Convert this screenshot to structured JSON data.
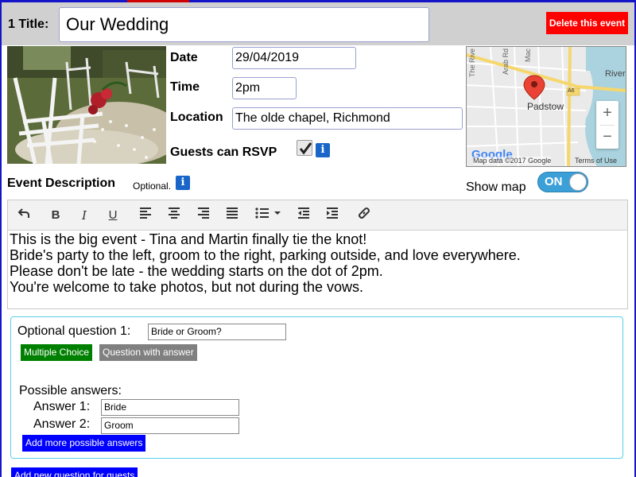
{
  "header": {
    "title_label": "1 Title:",
    "title_value": "Our Wedding",
    "delete_label": "Delete this event"
  },
  "details": {
    "date_label": "Date",
    "date_value": "29/04/2019",
    "time_label": "Time",
    "time_value": "2pm",
    "location_label": "Location",
    "location_value": "The olde chapel, Richmond",
    "rsvp_label": "Guests can RSVP",
    "rsvp_checked": true
  },
  "map": {
    "place_label": "Padstow",
    "river_label": "River",
    "road_a6": "A6",
    "street_1": "The Rive",
    "street_2": "Arab Rd",
    "street_3": "Mac",
    "attribution": "Map data ©2017 Google",
    "terms": "Terms of Use",
    "google_logo": "Google",
    "zoom_in": "+",
    "zoom_out": "−"
  },
  "description": {
    "label": "Event Description",
    "optional_note": "Optional.",
    "show_map_label": "Show map",
    "show_map_toggle": "ON",
    "lines": [
      "This is the big event - Tina and Martin finally tie the knot!",
      "Bride's party to the left, groom to the right, parking outside, and love everywhere.",
      "Please don't be late - the wedding starts on the dot of 2pm.",
      "You're welcome to take photos, but not during the vows."
    ]
  },
  "toolbar": {
    "icons": [
      "undo-icon",
      "bold-icon",
      "italic-icon",
      "underline-icon",
      "align-left-icon",
      "align-center-icon",
      "align-right-icon",
      "align-justify-icon",
      "bulleted-list-icon",
      "outdent-icon",
      "indent-icon",
      "link-icon"
    ]
  },
  "question": {
    "label": "Optional question 1:",
    "value": "Bride or Groom?",
    "multiple_choice_label": "Multiple Choice",
    "question_with_answer_label": "Question with answer",
    "possible_answers_label": "Possible answers:",
    "answers": [
      {
        "label": "Answer 1:",
        "value": "Bride"
      },
      {
        "label": "Answer 2:",
        "value": "Groom"
      }
    ],
    "add_answers_label": "Add more possible answers"
  },
  "footer": {
    "add_question_label": "Add new question for guests"
  },
  "colors": {
    "delete_button": "#ff0000",
    "toggle_on": "#3b9fd8",
    "multiple_choice": "#008000",
    "question_with_answer": "#808080",
    "add_button": "#0000ff",
    "panel_border": "#5ad0e8",
    "header_bg": "#d0d0d0"
  }
}
